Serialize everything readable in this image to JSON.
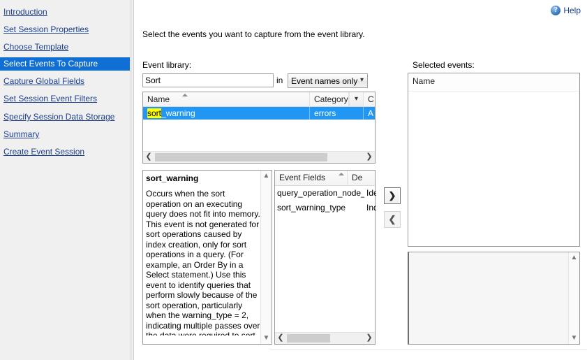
{
  "sidebar": {
    "items": [
      {
        "label": "Introduction",
        "state": "link"
      },
      {
        "label": "Set Session Properties",
        "state": "link"
      },
      {
        "label": "Choose Template",
        "state": "underlined"
      },
      {
        "label": "Select Events To Capture",
        "state": "selected"
      },
      {
        "label": "Capture Global Fields",
        "state": "link"
      },
      {
        "label": "Set Session Event Filters",
        "state": "link"
      },
      {
        "label": "Specify Session Data Storage",
        "state": "link"
      },
      {
        "label": "Summary",
        "state": "link"
      },
      {
        "label": "Create Event Session",
        "state": "link"
      }
    ]
  },
  "header": {
    "help_label": "Help",
    "help_icon": "help-circle-icon",
    "help_glyph": "?"
  },
  "main": {
    "instruction": "Select the events you want to capture from the event library.",
    "event_library_label": "Event library:",
    "selected_events_label": "Selected events:",
    "search": {
      "value": "Sort",
      "placeholder": "",
      "in_label": "in",
      "scope_value": "Event names only",
      "scope_chevron": "chevron-down-icon"
    },
    "event_grid": {
      "columns": [
        "Name",
        "Category",
        "C"
      ],
      "sort_column": "Name",
      "sort_direction": "ascending",
      "filter_chevron": "chevron-down-icon",
      "rows": [
        {
          "name_highlight": "sort",
          "name_rest": "_warning",
          "category": "errors",
          "other": "A"
        }
      ],
      "hscroll": {
        "left_arrow": "chevron-left-icon",
        "right_arrow": "chevron-right-icon"
      }
    },
    "description": {
      "title": "sort_warning",
      "body": "Occurs when the sort operation on an executing query does not fit into memory. This event is not generated for sort operations caused by index creation, only for sort operations in a query. (For example, an Order By in a Select statement.) Use this event to identify queries that perform slowly because of the sort operation, particularly when the warning_type = 2, indicating multiple passes over the data were required to sort",
      "scroll_up": "chevron-up-icon",
      "scroll_down": "chevron-down-icon"
    },
    "event_fields": {
      "columns": [
        "Event Fields",
        "De"
      ],
      "sort_column": "Event Fields",
      "sort_direction": "ascending",
      "rows": [
        {
          "name": "query_operation_node_id",
          "description": "Ide"
        },
        {
          "name": "sort_warning_type",
          "description": "Ind"
        }
      ],
      "hscroll": {
        "left_arrow": "chevron-left-icon",
        "right_arrow": "chevron-right-icon"
      }
    },
    "move_buttons": {
      "add_label": "❯",
      "remove_label": "❮"
    },
    "selected_events": {
      "columns": [
        "Name"
      ],
      "rows": []
    },
    "detail_panel": {
      "scroll_up": "chevron-up-icon",
      "scroll_down": "chevron-down-icon"
    }
  },
  "colors": {
    "accent": "#0f6fd4",
    "row_selected": "#2196f3",
    "highlight": "#ffff00",
    "link": "#1a3f8f"
  }
}
